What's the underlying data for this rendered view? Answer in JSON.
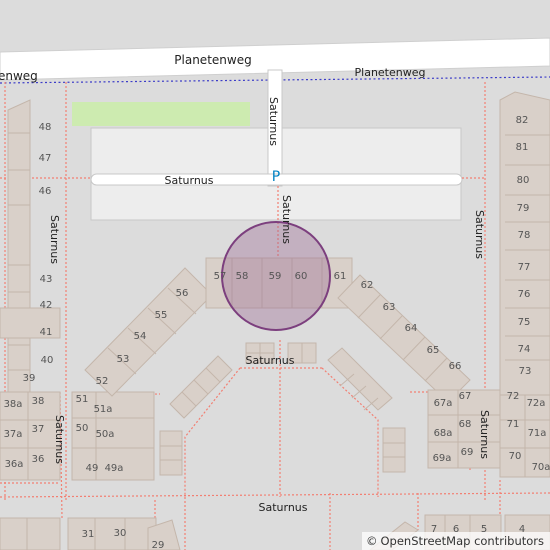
{
  "map": {
    "roads": {
      "planetenweg_main": "Planetenweg",
      "planetenweg_left": "enweg",
      "planetenweg_path": "Planetenweg",
      "saturnus_vertical": "Saturnus",
      "saturnus_parking_row": "Saturnus",
      "saturnus_diag": "Saturnus",
      "saturnus_center": "Saturnus",
      "saturnus_bottom": "Saturnus",
      "saturnus_left_upper": "Saturnus",
      "saturnus_left_lower": "Saturnus",
      "saturnus_right_upper": "Saturnus",
      "saturnus_right_lower": "Saturnus"
    },
    "parking_symbol": "P",
    "house_numbers": {
      "left_column": [
        "48",
        "47",
        "46",
        "43",
        "42",
        "41",
        "40",
        "39"
      ],
      "left_lower": [
        "38a",
        "38",
        "37a",
        "37",
        "36a",
        "36"
      ],
      "left_block": [
        "51",
        "51a",
        "50",
        "50a",
        "49",
        "49a"
      ],
      "arc_left": [
        "57",
        "56",
        "55",
        "54",
        "53",
        "52"
      ],
      "arc_top": [
        "58",
        "59",
        "60",
        "61"
      ],
      "arc_right": [
        "62",
        "63",
        "64",
        "65",
        "66"
      ],
      "right_block": [
        "67",
        "67a",
        "68",
        "68a",
        "69",
        "69a"
      ],
      "right_column": [
        "82",
        "81",
        "80",
        "79",
        "78",
        "77",
        "76",
        "75",
        "74",
        "73"
      ],
      "right_lower": [
        "72",
        "72a",
        "71",
        "71a",
        "70",
        "70a"
      ],
      "bottom_row": [
        "31",
        "30",
        "29",
        "7",
        "6",
        "5",
        "4"
      ]
    },
    "marker": {
      "fill": "#9a6a94",
      "stroke": "#7c3f7e"
    },
    "colors": {
      "background": "#dcdcdc",
      "building": "#d9d0c9",
      "building_stroke": "#c4b6ab",
      "road": "#ffffff",
      "path": "#f27f72",
      "cycleway": "#3c3cc8",
      "grass": "#cdebb0",
      "parking": "#ededed",
      "parking_accent": "#0082c3"
    }
  },
  "attribution": {
    "copyright": "©",
    "text": "OpenStreetMap contributors"
  }
}
